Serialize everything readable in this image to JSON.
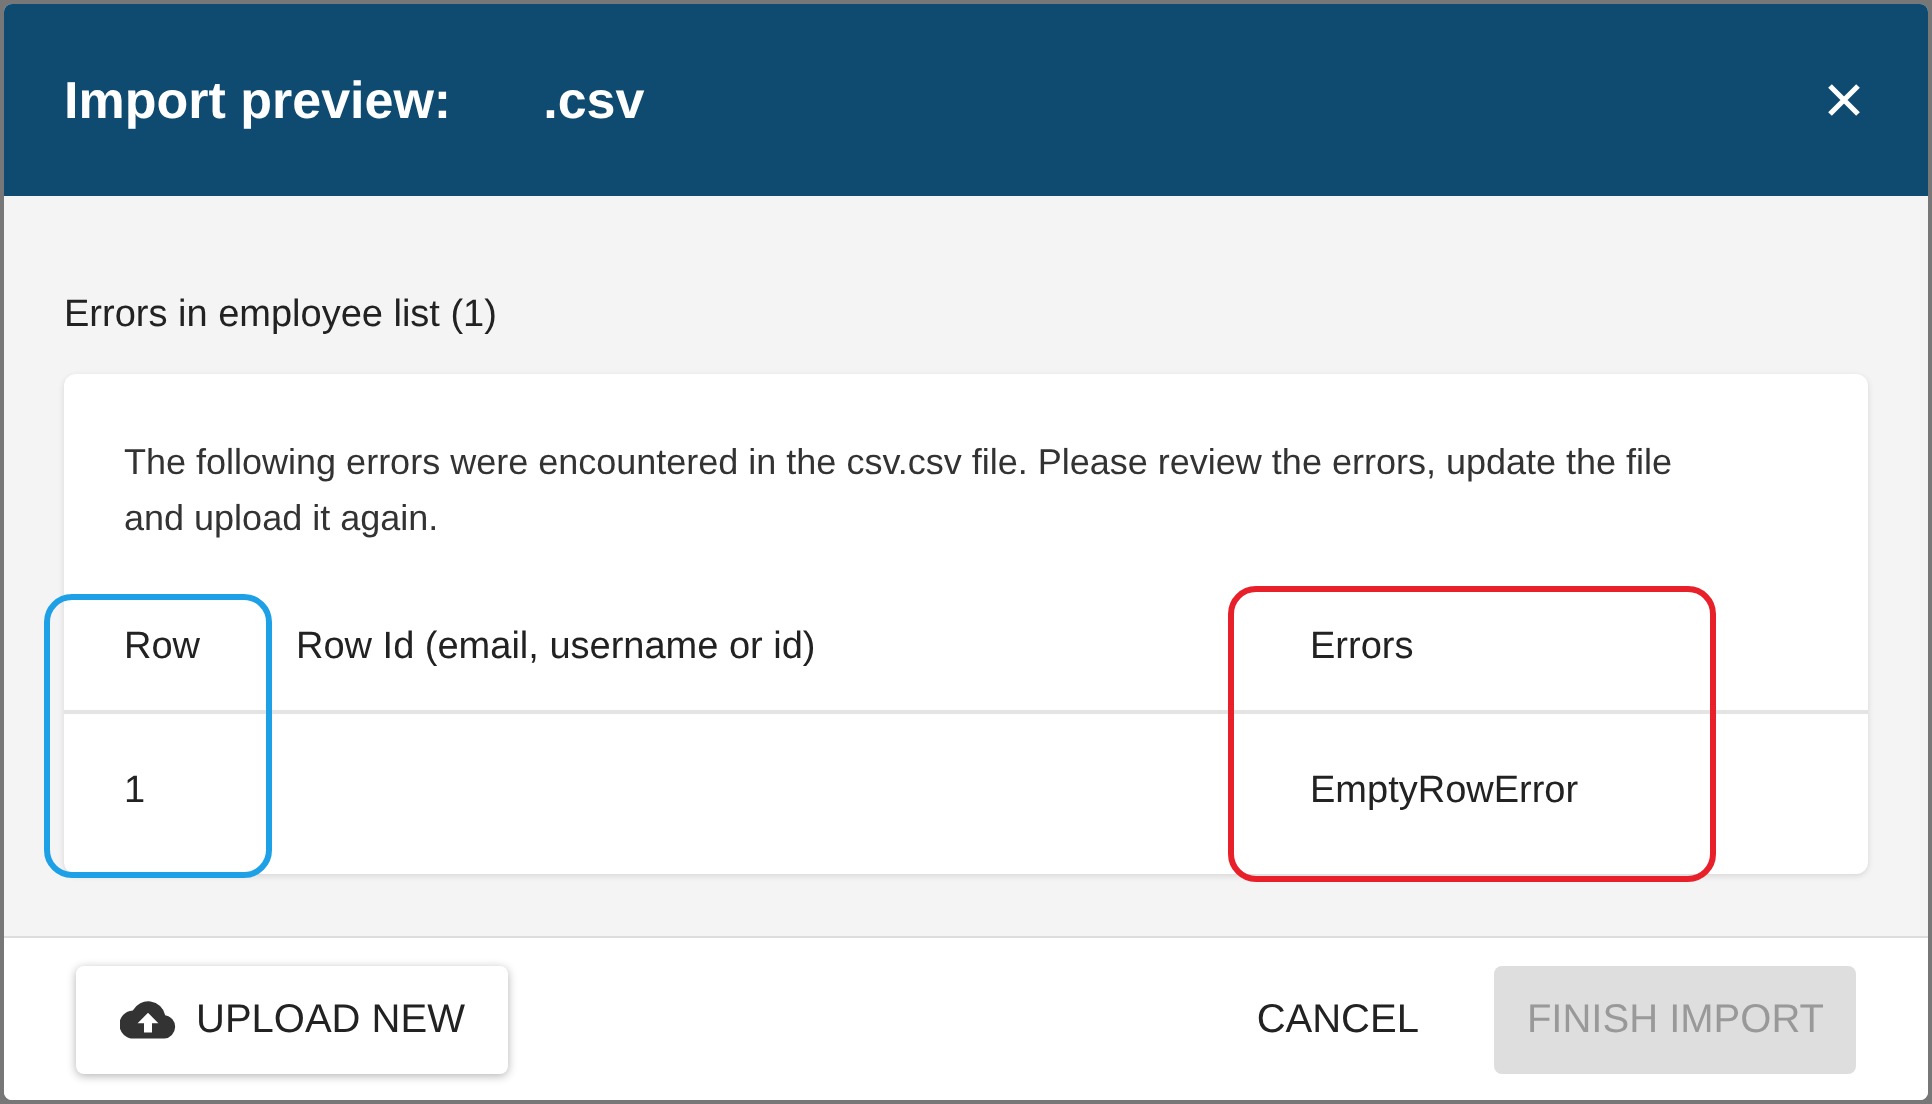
{
  "dialog": {
    "title": "Import preview:",
    "file_name": ".csv"
  },
  "section_title": "Errors in employee list (1)",
  "message": "The following errors were encountered in the csv.csv file. Please review the errors, update the file and upload it again.",
  "table": {
    "columns": [
      "Row",
      "Row Id (email, username or id)",
      "Errors"
    ],
    "rows": [
      [
        "1",
        "",
        "EmptyRowError"
      ]
    ]
  },
  "highlights": [
    {
      "color": "#1ea0e6"
    },
    {
      "color": "#e8202a"
    }
  ],
  "buttons": [
    {
      "label": "UPLOAD NEW",
      "kind": "upload",
      "disabled": false
    },
    {
      "label": "CANCEL",
      "kind": "text",
      "disabled": false
    },
    {
      "label": "FINISH IMPORT",
      "kind": "primary",
      "disabled": true
    }
  ]
}
